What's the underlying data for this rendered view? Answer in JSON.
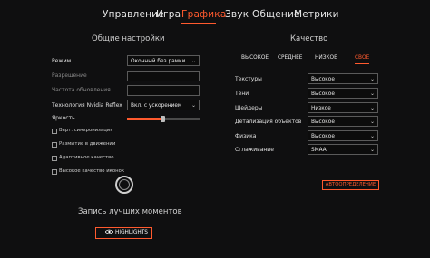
{
  "nav": {
    "tabs": [
      {
        "label": "Управление",
        "active": false
      },
      {
        "label": "Игра",
        "active": false
      },
      {
        "label": "Графика",
        "active": true
      },
      {
        "label": "Звук",
        "active": false
      },
      {
        "label": "Общение",
        "active": false
      },
      {
        "label": "Метрики",
        "active": false
      }
    ]
  },
  "general": {
    "title": "Общие настройки",
    "rows": [
      {
        "label": "Режим",
        "value": "Оконный без рамки",
        "enabled": true
      },
      {
        "label": "Разрешение",
        "value": "",
        "enabled": false
      },
      {
        "label": "Частота обновления",
        "value": "",
        "enabled": false
      },
      {
        "label": "Технология Nvidia Reflex",
        "value": "Вкл. с ускорением",
        "enabled": true
      }
    ],
    "brightness_label": "Яркость",
    "brightness_value": 0.5,
    "checkboxes": [
      {
        "label": "Верт. синхронизация",
        "checked": false
      },
      {
        "label": "Размытие в движении",
        "checked": false
      },
      {
        "label": "Адаптивное качество",
        "checked": false
      },
      {
        "label": "Высокое качество иконок",
        "checked": false
      }
    ]
  },
  "quality": {
    "title": "Качество",
    "presets": [
      {
        "label": "ВЫСОКОЕ",
        "active": false
      },
      {
        "label": "СРЕДНЕЕ",
        "active": false
      },
      {
        "label": "НИЗКОЕ",
        "active": false
      },
      {
        "label": "СВОЕ",
        "active": true
      }
    ],
    "rows": [
      {
        "label": "Текстуры",
        "value": "Высокое"
      },
      {
        "label": "Тени",
        "value": "Высокое"
      },
      {
        "label": "Шейдеры",
        "value": "Низкое"
      },
      {
        "label": "Детализация объектов",
        "value": "Высокое"
      },
      {
        "label": "Физика",
        "value": "Высокое"
      },
      {
        "label": "Сглаживание",
        "value": "SMAA"
      }
    ],
    "auto_button": "АВТООПРЕДЕЛЕНИЕ"
  },
  "highlights": {
    "title": "Запись лучших моментов",
    "button": "HIGHLIGHTS"
  },
  "colors": {
    "accent": "#ff5a2e",
    "background": "#0f0f10"
  },
  "icons": {
    "chevron": "chevron-down-icon",
    "record": "record-ring-icon",
    "nvidia": "nvidia-logo-icon"
  }
}
